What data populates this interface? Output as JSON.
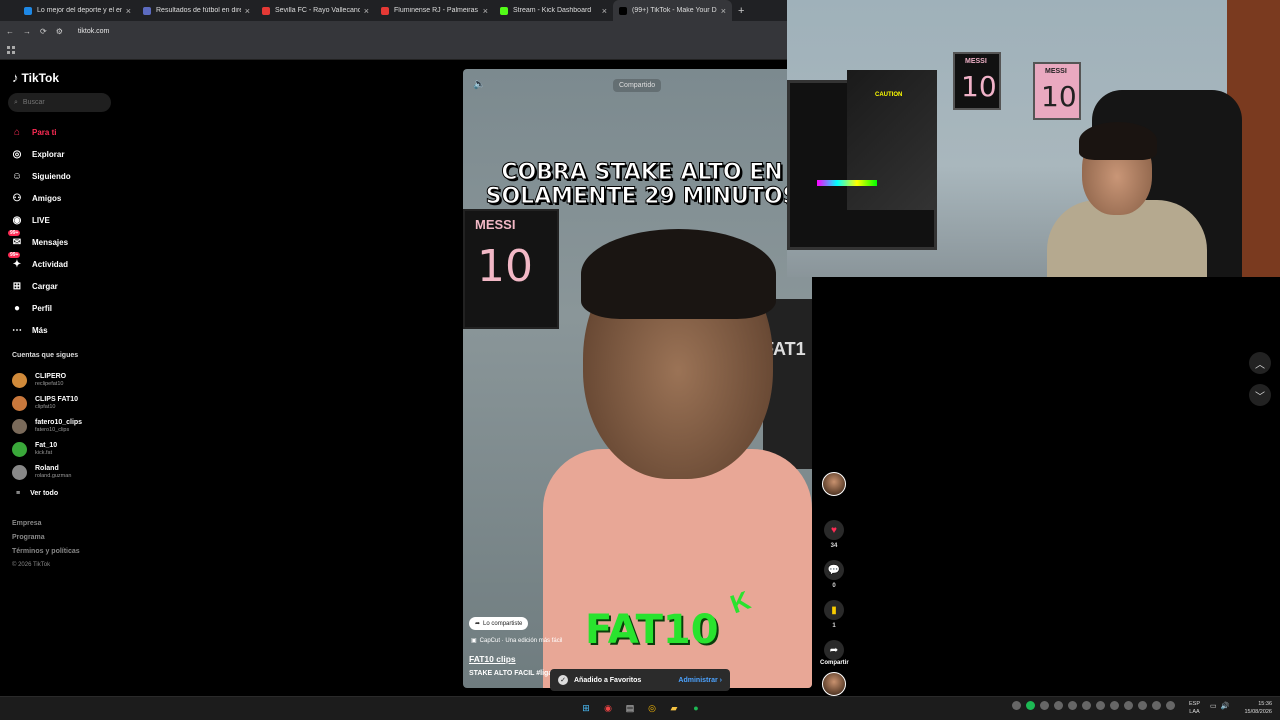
{
  "browser": {
    "tabs": [
      {
        "title": "Lo mejor del deporte y el entre",
        "color": "#1e88e5"
      },
      {
        "title": "Resultados de fútbol en directo",
        "color": "#5c6bc0"
      },
      {
        "title": "Sevilla FC - Rayo Vallecano Cuo",
        "color": "#e53935"
      },
      {
        "title": "Fluminense RJ - Palmeiras SP C",
        "color": "#e53935"
      },
      {
        "title": "Stream - Kick Dashboard",
        "color": "#53fc18"
      },
      {
        "title": "(99+) TikTok - Make Your D",
        "color": "#000000"
      }
    ],
    "url": "tiktok.com"
  },
  "sidebar": {
    "logo": "TikTok",
    "search_placeholder": "Buscar",
    "nav": [
      {
        "label": "Para ti",
        "icon": "home-icon"
      },
      {
        "label": "Explorar",
        "icon": "compass-icon"
      },
      {
        "label": "Siguiendo",
        "icon": "following-icon"
      },
      {
        "label": "Amigos",
        "icon": "friends-icon"
      },
      {
        "label": "LIVE",
        "icon": "live-icon"
      },
      {
        "label": "Mensajes",
        "icon": "messages-icon",
        "badge": "99+"
      },
      {
        "label": "Actividad",
        "icon": "activity-icon",
        "badge": "99+"
      },
      {
        "label": "Cargar",
        "icon": "upload-icon"
      },
      {
        "label": "Perfil",
        "icon": "profile-icon"
      },
      {
        "label": "Más",
        "icon": "more-icon"
      }
    ],
    "following_title": "Cuentas que sigues",
    "following": [
      {
        "name": "CLIPERO",
        "handle": "reclipefat10",
        "color": "#d08a3a"
      },
      {
        "name": "CLIPS FAT10",
        "handle": "clipfat10",
        "color": "#c9783c"
      },
      {
        "name": "fatero10_clips",
        "handle": "fatero10_clips",
        "color": "#7a6a5a"
      },
      {
        "name": "Fat_10",
        "handle": "kick.fat",
        "color": "#3aa83a"
      },
      {
        "name": "Roland",
        "handle": "roland.guzman",
        "color": "#888888"
      }
    ],
    "see_all": "Ver todo",
    "footer": [
      "Empresa",
      "Programa",
      "Términos y políticas"
    ],
    "copyright": "© 2026 TikTok"
  },
  "video": {
    "shared_label": "Compartido",
    "overlay_title": "COBRA STAKE ALTO EN SOLAMENTE 29 MINUTOS",
    "poster_text": "MESSI",
    "poster_number": "10",
    "chair_text": "FAT1",
    "brand_text": "FAT10",
    "brand_k": "K",
    "shared_chip": "Lo compartiste",
    "capcut": "CapCut · Una edición más fácil",
    "author": "FAT10 clips",
    "description": "STAKE ALTO FACIL #ligaf"
  },
  "actions": {
    "likes": "34",
    "comments": "0",
    "saves": "1",
    "share_label": "Compartir"
  },
  "toast": {
    "message": "Añadido a Favoritos",
    "manage": "Administrar"
  },
  "webcam": {
    "poster1_top": "MESSI",
    "poster1_num": "10",
    "poster2_top": "MESSI",
    "poster2_num": "10",
    "case_label": "CAUTION"
  },
  "taskbar": {
    "lang_top": "ESP",
    "lang_bottom": "LAA",
    "time": "15:36",
    "date": "15/08/2026"
  }
}
